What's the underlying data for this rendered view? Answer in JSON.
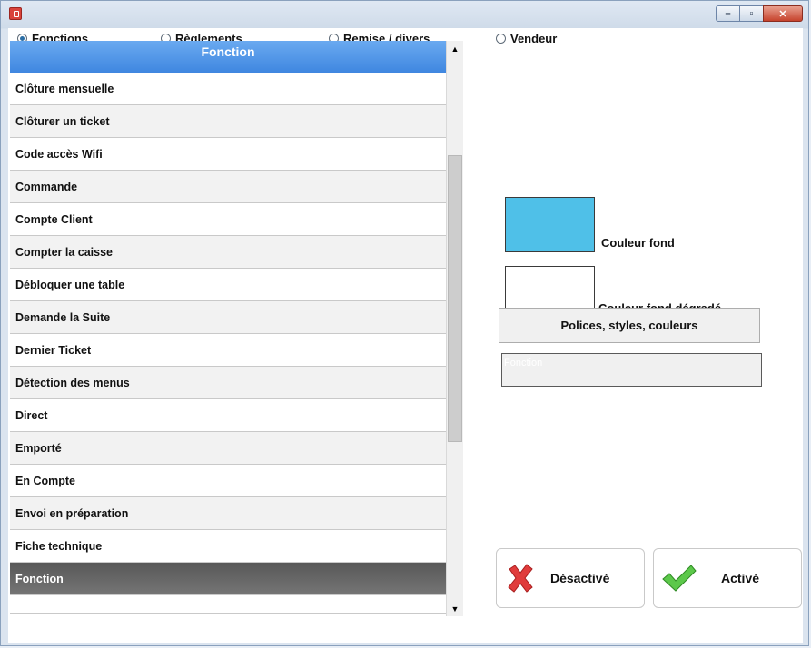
{
  "window": {
    "min_glyph": "–",
    "restore_glyph": "▫",
    "close_glyph": "✕"
  },
  "radios": [
    {
      "label": "Fonctions",
      "selected": true
    },
    {
      "label": "Règlements",
      "selected": false
    },
    {
      "label": "Remise / divers",
      "selected": false
    },
    {
      "label": "Vendeur",
      "selected": false
    }
  ],
  "list": {
    "header": "Fonction",
    "items": [
      "Clôture mensuelle",
      "Clôturer un ticket",
      "Code accès Wifi",
      "Commande",
      "Compte Client",
      "Compter la caisse",
      "Débloquer une table",
      "Demande la Suite",
      "Dernier Ticket",
      "Détection des menus",
      "Direct",
      "Emporté",
      "En Compte",
      "Envoi en préparation",
      "Fiche technique"
    ],
    "selected_item": "Fonction"
  },
  "colors": {
    "background_color": "#4fc0e8",
    "gradient_color": "#ffffff",
    "label_background": "Couleur fond",
    "label_gradient": "Couleur fond dégradé"
  },
  "fonts_button": "Polices, styles, couleurs",
  "preview_text": "Fonction",
  "actions": {
    "deactivate": "Désactivé",
    "activate": "Activé"
  }
}
